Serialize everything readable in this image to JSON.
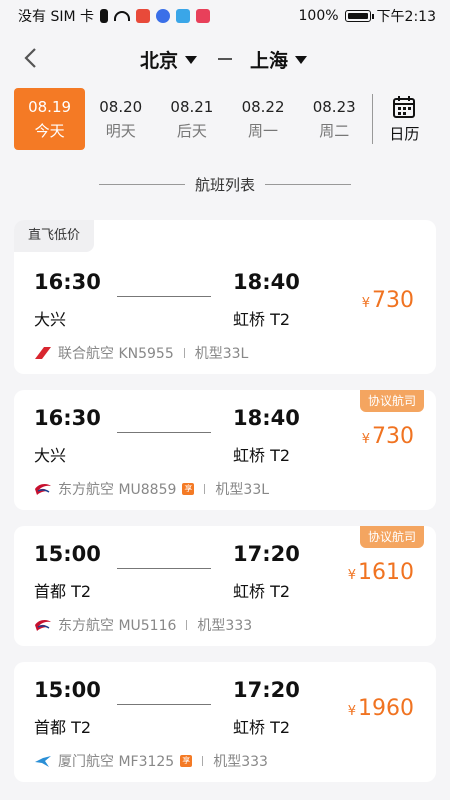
{
  "status": {
    "carrier": "没有 SIM 卡",
    "battery": "100%",
    "time": "下午2:13"
  },
  "header": {
    "from": "北京",
    "to": "上海"
  },
  "dates": [
    {
      "date": "08.19",
      "label": "今天"
    },
    {
      "date": "08.20",
      "label": "明天"
    },
    {
      "date": "08.21",
      "label": "后天"
    },
    {
      "date": "08.22",
      "label": "周一"
    },
    {
      "date": "08.23",
      "label": "周二"
    }
  ],
  "calendar_label": "日历",
  "section_title": "航班列表",
  "flights": [
    {
      "tag": "直飞低价",
      "dep_time": "16:30",
      "dep_airport": "大兴",
      "arr_time": "18:40",
      "arr_airport": "虹桥 T2",
      "currency": "¥",
      "price": "730",
      "airline": "联合航空 KN5955",
      "aircraft": "机型33L"
    },
    {
      "badge": "协议航司",
      "dep_time": "16:30",
      "dep_airport": "大兴",
      "arr_time": "18:40",
      "arr_airport": "虹桥 T2",
      "currency": "¥",
      "price": "730",
      "airline": "东方航空 MU8859",
      "share": "享",
      "aircraft": "机型33L"
    },
    {
      "badge": "协议航司",
      "dep_time": "15:00",
      "dep_airport": "首都 T2",
      "arr_time": "17:20",
      "arr_airport": "虹桥 T2",
      "currency": "¥",
      "price": "1610",
      "airline": "东方航空 MU5116",
      "aircraft": "机型333"
    },
    {
      "dep_time": "15:00",
      "dep_airport": "首都 T2",
      "arr_time": "17:20",
      "arr_airport": "虹桥 T2",
      "currency": "¥",
      "price": "1960",
      "airline": "厦门航空 MF3125",
      "share": "享",
      "aircraft": "机型333"
    }
  ],
  "colors": {
    "accent": "#f47a25",
    "price": "#f07321",
    "badge": "#f4a560"
  }
}
